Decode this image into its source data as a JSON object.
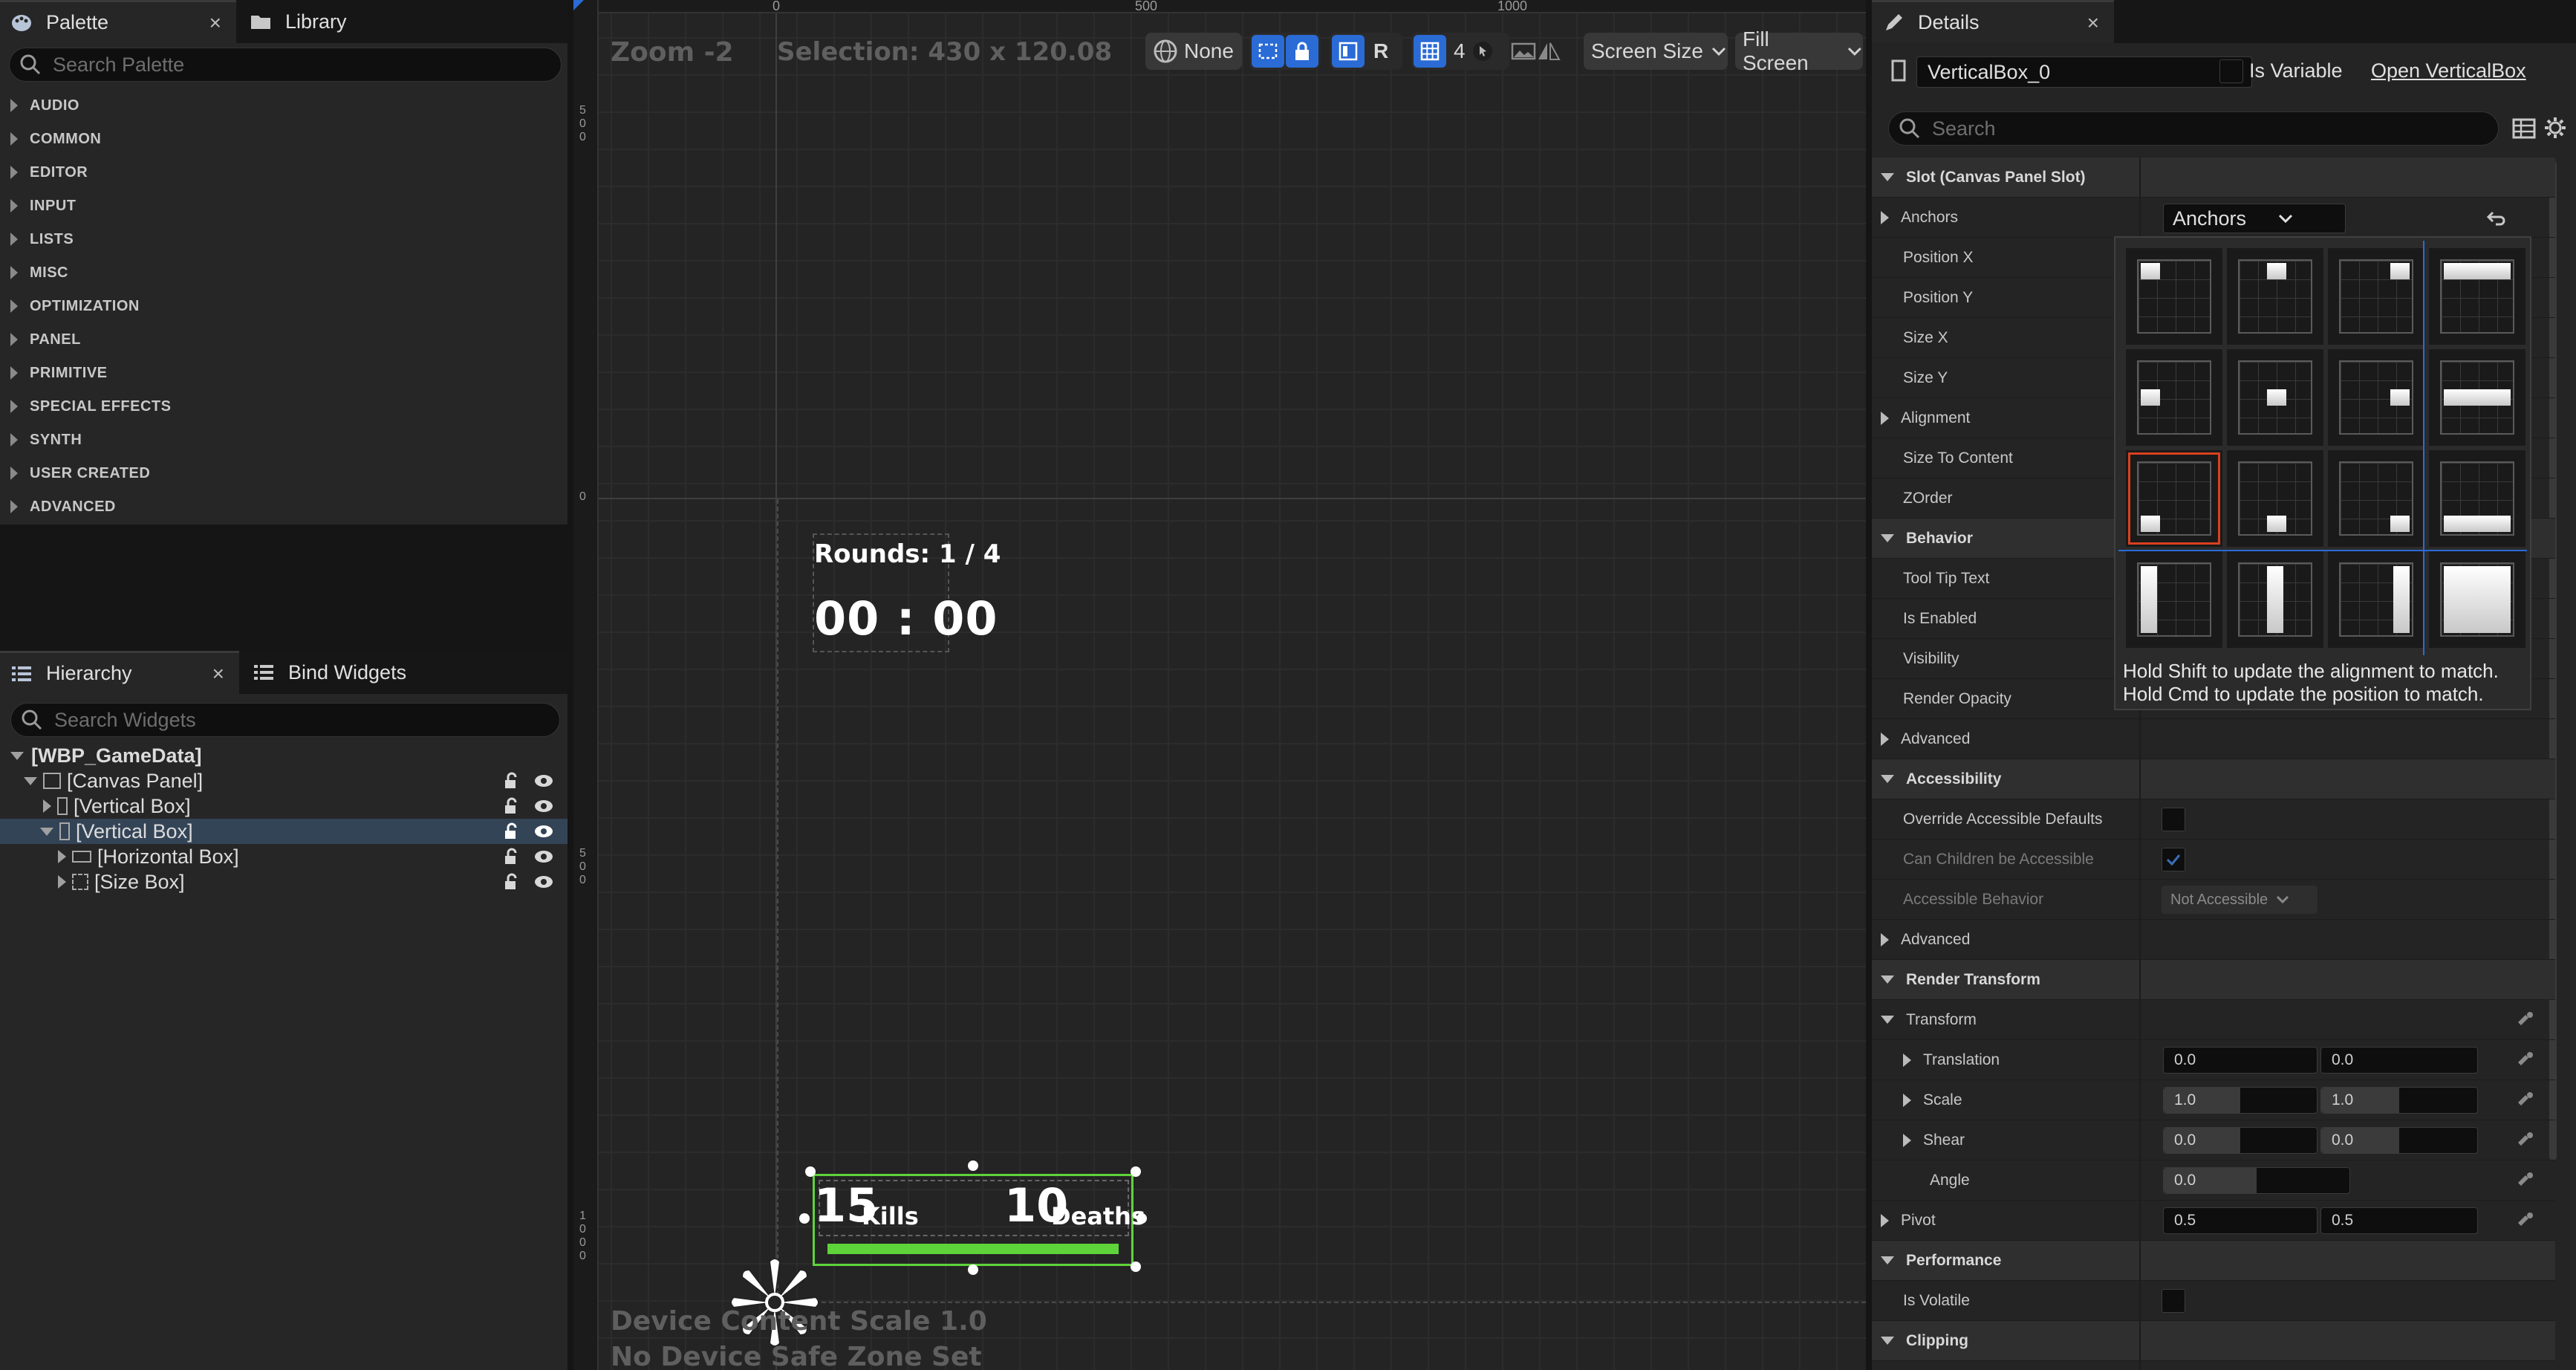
{
  "palette_tab": {
    "label": "Palette",
    "close": "×"
  },
  "library_tab": {
    "label": "Library"
  },
  "palette_search": {
    "placeholder": "Search Palette"
  },
  "categories": [
    "AUDIO",
    "COMMON",
    "EDITOR",
    "INPUT",
    "LISTS",
    "MISC",
    "OPTIMIZATION",
    "PANEL",
    "PRIMITIVE",
    "SPECIAL EFFECTS",
    "SYNTH",
    "USER CREATED",
    "ADVANCED"
  ],
  "hierarchy_tab": {
    "label": "Hierarchy",
    "close": "×"
  },
  "bind_widgets_tab": {
    "label": "Bind Widgets"
  },
  "hierarchy_search": {
    "placeholder": "Search Widgets"
  },
  "tree": [
    {
      "label": "[WBP_GameData]"
    },
    {
      "label": "[Canvas Panel]"
    },
    {
      "label": "[Vertical Box]"
    },
    {
      "label": "[Vertical Box]"
    },
    {
      "label": "[Horizontal Box]"
    },
    {
      "label": "[Size Box]"
    }
  ],
  "viewport": {
    "zoom": "Zoom -2",
    "selection": "Selection: 430 x 120.08",
    "ruler_top": [
      "0",
      "500",
      "1000"
    ],
    "ruler_left": [
      "500",
      "0",
      "500",
      "1000"
    ],
    "toolbar": {
      "none": "None",
      "r": "R",
      "grid_snap": "4",
      "screen_size": "Screen Size",
      "fill_screen": "Fill Screen"
    },
    "dpi_text": "Device Content Scale 1.0",
    "safe_zone_text": "No Device Safe Zone Set"
  },
  "game": {
    "rounds": "Rounds: 1 / 4",
    "timer": "00 : 00",
    "kills_value": "15",
    "kills_label": "Kills",
    "deaths_value": "10",
    "deaths_label": "Deaths"
  },
  "details": {
    "tab": "Details",
    "close": "×",
    "widget_name": "VerticalBox_0",
    "is_variable": "Is Variable",
    "open_link": "Open VerticalBox",
    "search_placeholder": "Search",
    "slot_section": "Slot (Canvas Panel Slot)",
    "anchors_label": "Anchors",
    "anchors_value": "Anchors",
    "slot_rows": [
      "Position X",
      "Position Y",
      "Size X",
      "Size Y",
      "Alignment",
      "Size To Content",
      "ZOrder"
    ],
    "behavior_section": "Behavior",
    "behavior_rows": [
      "Tool Tip Text",
      "Is Enabled",
      "Visibility",
      "Render Opacity",
      "Advanced"
    ],
    "accessibility_section": "Accessibility",
    "override_label": "Override Accessible Defaults",
    "children_label": "Can Children be Accessible",
    "behavior_label": "Accessible Behavior",
    "behavior_value": "Not Accessible",
    "acc_advanced": "Advanced",
    "render_transform_section": "Render Transform",
    "transform_label": "Transform",
    "translation_label": "Translation",
    "translation_x": "0.0",
    "translation_y": "0.0",
    "scale_label": "Scale",
    "scale_x": "1.0",
    "scale_y": "1.0",
    "shear_label": "Shear",
    "shear_x": "0.0",
    "shear_y": "0.0",
    "angle_label": "Angle",
    "angle_value": "0.0",
    "pivot_label": "Pivot",
    "pivot_x": "0.5",
    "pivot_y": "0.5",
    "performance_section": "Performance",
    "is_volatile": "Is Volatile",
    "clipping_section": "Clipping"
  },
  "anchor_popup": {
    "hint_1": "Hold Shift to update the alignment to match.",
    "hint_2": "Hold Cmd to update the position to match."
  },
  "colors": {
    "accent_blue": "#2a6bd6",
    "selection_green": "#5fd33a",
    "anchor_selected": "#d9401e"
  }
}
